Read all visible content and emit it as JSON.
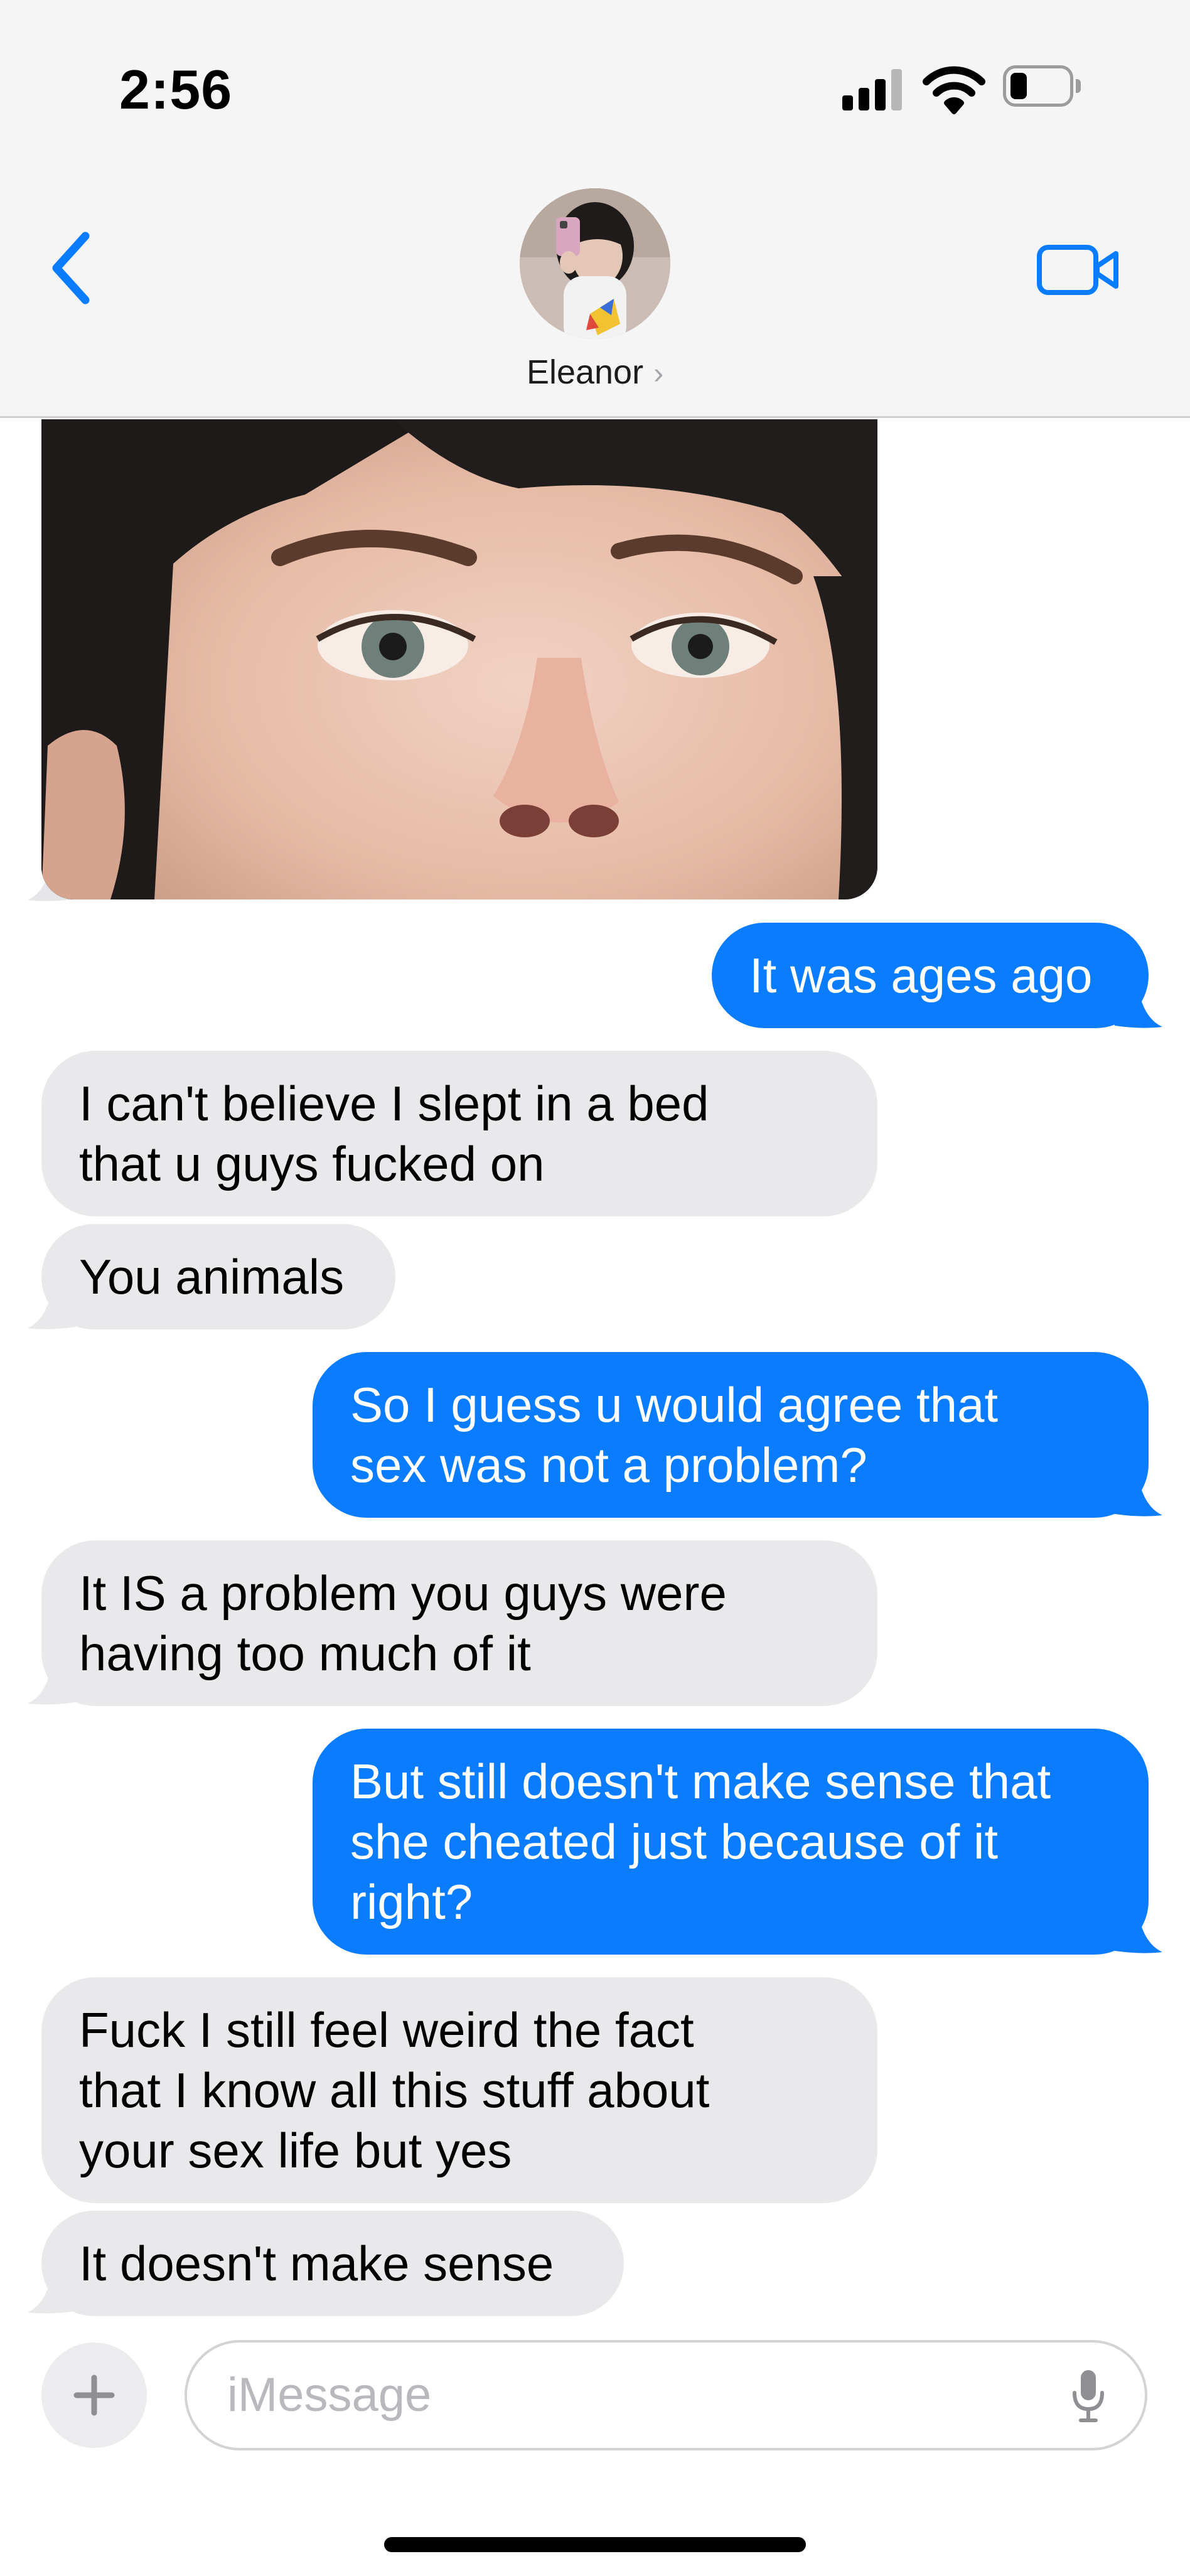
{
  "status_bar": {
    "time": "2:56"
  },
  "header": {
    "contact_name": "Eleanor",
    "name_chevron": "›"
  },
  "messages": [
    {
      "from": "them",
      "type": "photo"
    },
    {
      "from": "me",
      "text": "It was ages ago"
    },
    {
      "from": "them",
      "lines": [
        "I can't believe I slept in a bed",
        "that u guys fucked on"
      ]
    },
    {
      "from": "them",
      "text": "You animals"
    },
    {
      "from": "me",
      "lines": [
        "So I guess u would agree that",
        "sex was not a problem?"
      ]
    },
    {
      "from": "them",
      "lines": [
        "It IS a problem you guys were",
        "having too much of it"
      ]
    },
    {
      "from": "me",
      "lines": [
        "But still doesn't make sense that",
        "she cheated just because of it",
        "right?"
      ]
    },
    {
      "from": "them",
      "lines": [
        "Fuck I still feel weird the fact",
        "that I know all this stuff about",
        "your sex life but yes"
      ]
    },
    {
      "from": "them",
      "text": "It doesn't make sense"
    }
  ],
  "composer": {
    "placeholder": "iMessage",
    "plus_label": "+"
  },
  "colors": {
    "incoming_bubble": "#e9e9eb",
    "outgoing_bubble": "#0a7cff",
    "accent": "#0a7cff",
    "header_bg": "#f5f5f5"
  },
  "icons": {
    "back": "chevron-left-icon",
    "video": "video-camera-icon",
    "mic": "microphone-icon",
    "signal": "cellular-signal-icon",
    "wifi": "wifi-icon",
    "battery": "battery-icon"
  }
}
